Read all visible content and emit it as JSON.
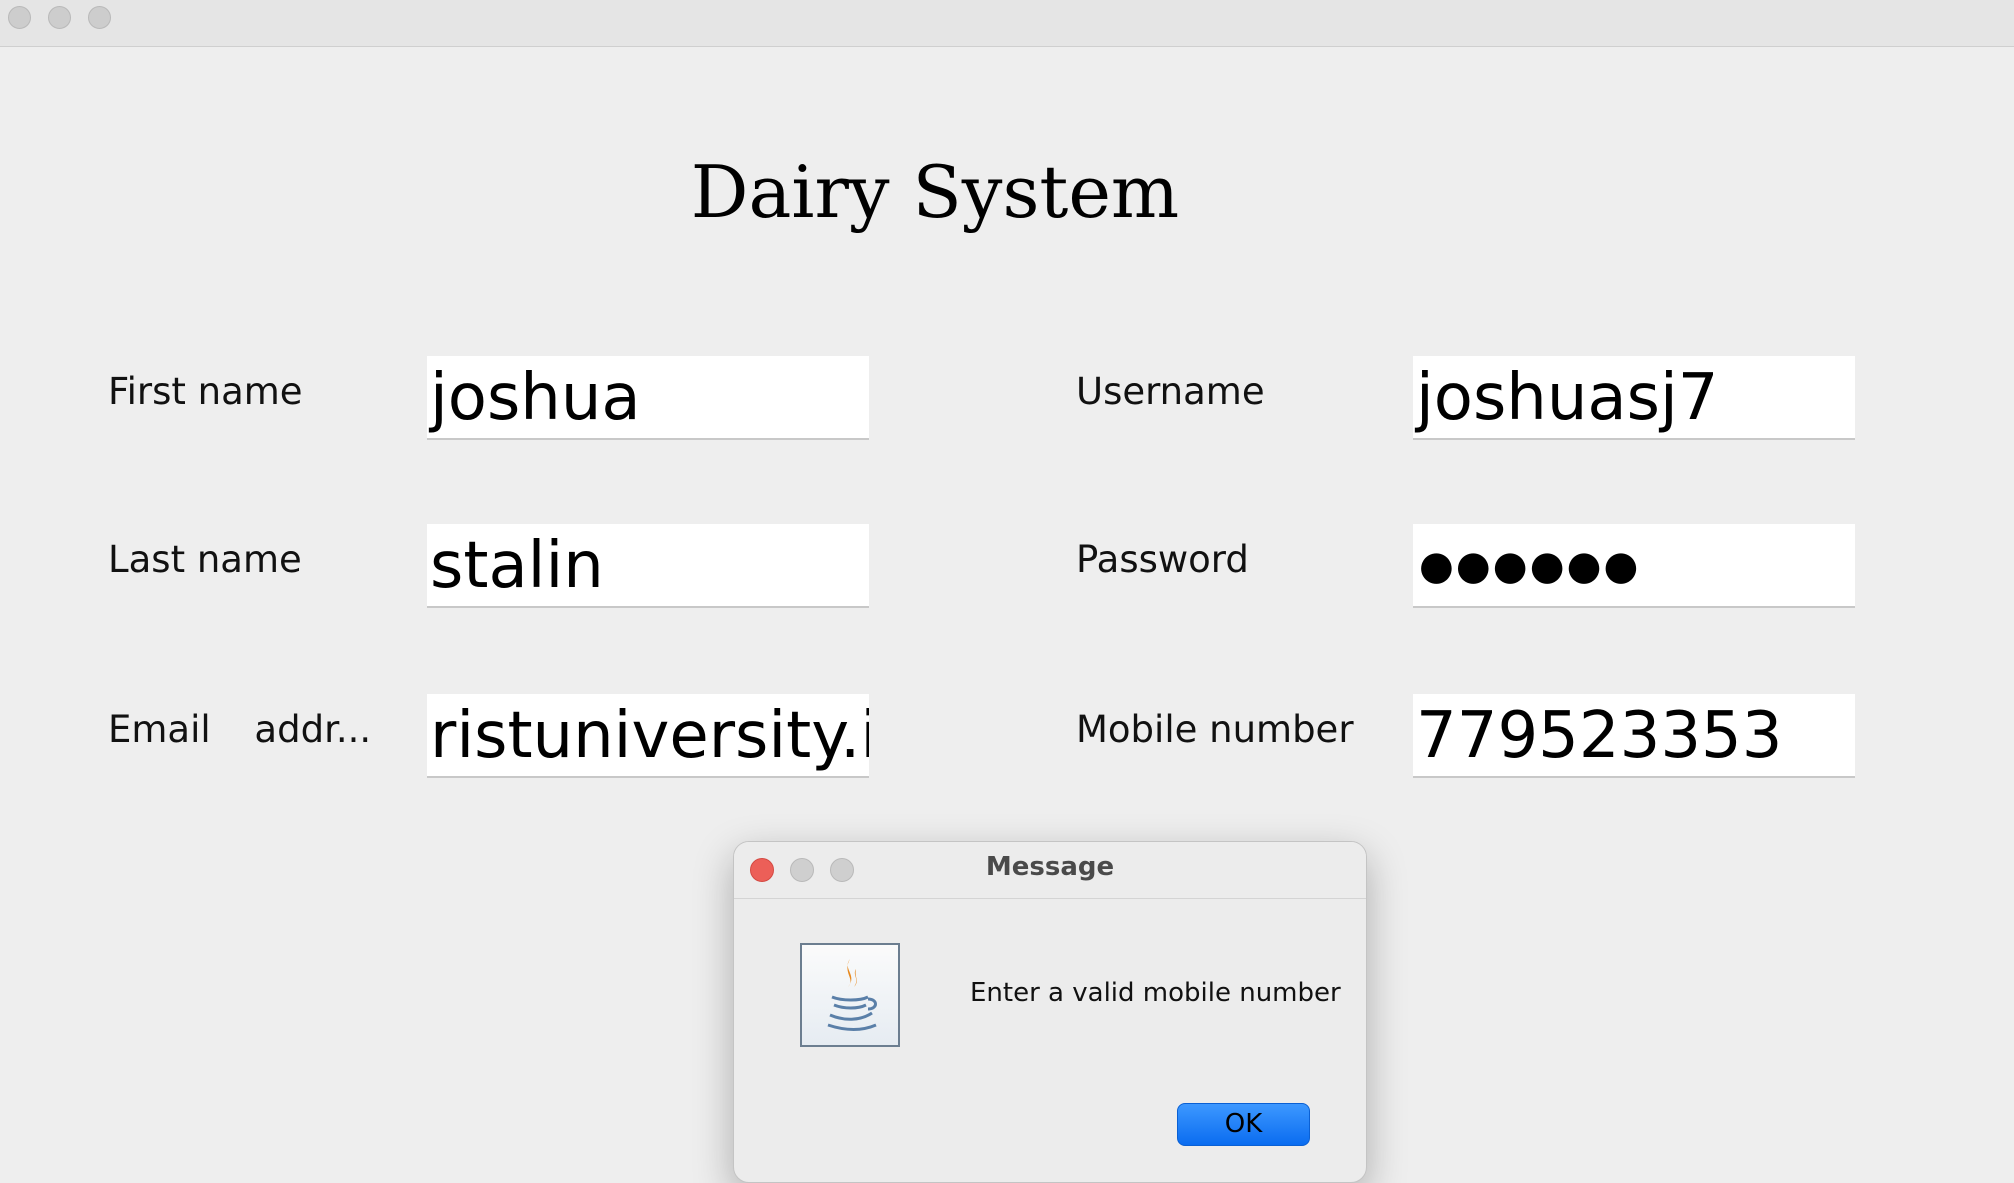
{
  "window": {
    "title": ""
  },
  "app_title": "Dairy System",
  "form": {
    "first_name_label": "First name",
    "first_name_value": "joshua",
    "last_name_label": "Last name",
    "last_name_value": "stalin",
    "email_label_part1": "Email",
    "email_label_part2": "addr...",
    "email_value": "ristuniversity.in",
    "username_label": "Username",
    "username_value": "joshuasj7",
    "password_label": "Password",
    "password_value": "●●●●●●",
    "mobile_label": "Mobile number",
    "mobile_value": "779523353"
  },
  "dialog": {
    "title": "Message",
    "message": "Enter a valid mobile number",
    "ok_label": "OK",
    "icon": "java-icon",
    "close_color": "#ec5f58"
  }
}
